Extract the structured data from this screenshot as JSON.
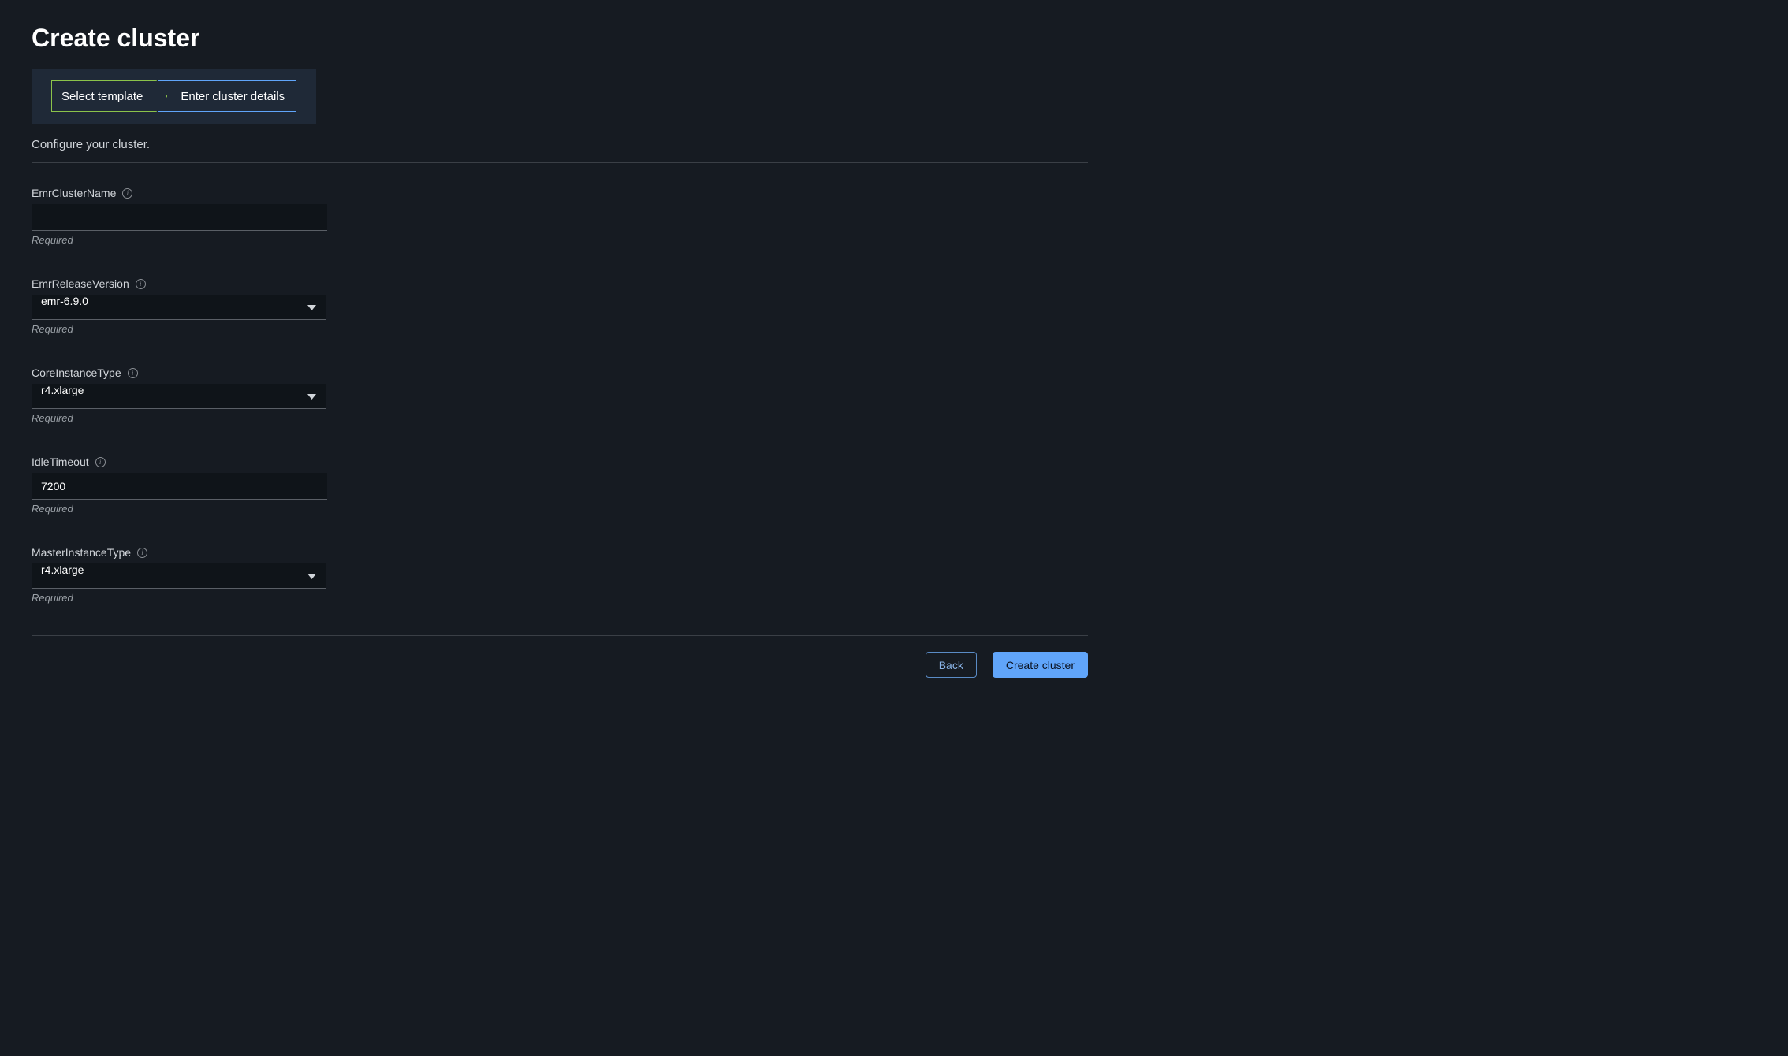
{
  "page": {
    "title": "Create cluster",
    "subtitle": "Configure your cluster."
  },
  "stepper": {
    "step1": "Select template",
    "step2": "Enter cluster details"
  },
  "fields": {
    "clusterName": {
      "label": "EmrClusterName",
      "value": "",
      "helper": "Required"
    },
    "releaseVersion": {
      "label": "EmrReleaseVersion",
      "value": "emr-6.9.0",
      "helper": "Required"
    },
    "coreInstanceType": {
      "label": "CoreInstanceType",
      "value": "r4.xlarge",
      "helper": "Required"
    },
    "idleTimeout": {
      "label": "IdleTimeout",
      "value": "7200",
      "helper": "Required"
    },
    "masterInstanceType": {
      "label": "MasterInstanceType",
      "value": "r4.xlarge",
      "helper": "Required"
    }
  },
  "buttons": {
    "back": "Back",
    "create": "Create cluster"
  }
}
